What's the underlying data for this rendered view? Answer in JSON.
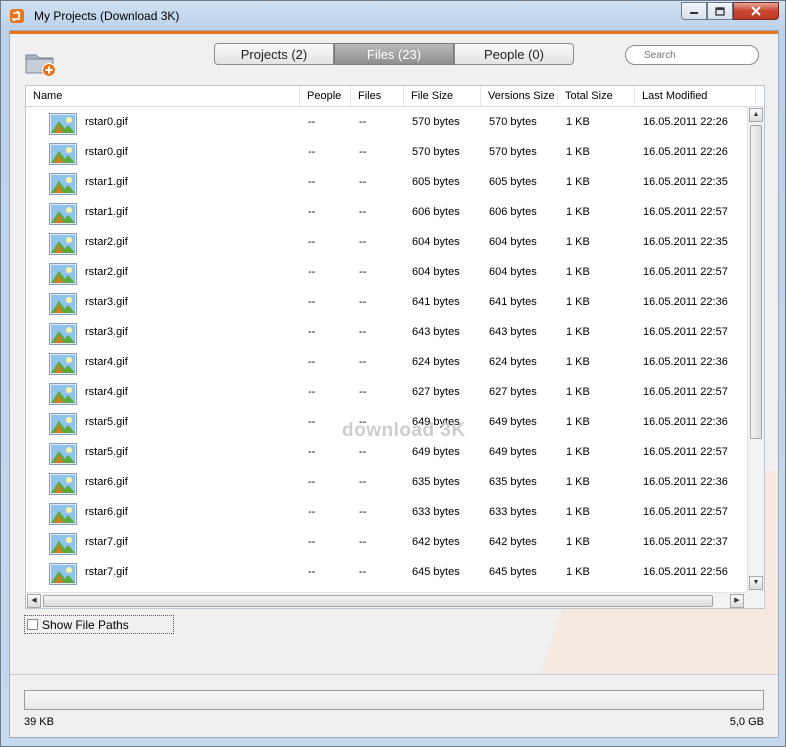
{
  "window": {
    "title": "My Projects (Download 3K)"
  },
  "tabs": [
    {
      "label": "Projects (2)"
    },
    {
      "label": "Files (23)"
    },
    {
      "label": "People (0)"
    }
  ],
  "active_tab": "Files (23)",
  "search": {
    "placeholder": "Search"
  },
  "table": {
    "columns": [
      "Name",
      "People",
      "Files",
      "File Size",
      "Versions Size",
      "Total Size",
      "Last Modified"
    ],
    "rows": [
      {
        "name": "rstar0.gif",
        "people": "--",
        "files": "--",
        "file_size": "570 bytes",
        "versions_size": "570 bytes",
        "total_size": "1 KB",
        "modified": "16.05.2011 22:26"
      },
      {
        "name": "rstar0.gif",
        "people": "--",
        "files": "--",
        "file_size": "570 bytes",
        "versions_size": "570 bytes",
        "total_size": "1 KB",
        "modified": "16.05.2011 22:26"
      },
      {
        "name": "rstar1.gif",
        "people": "--",
        "files": "--",
        "file_size": "605 bytes",
        "versions_size": "605 bytes",
        "total_size": "1 KB",
        "modified": "16.05.2011 22:35"
      },
      {
        "name": "rstar1.gif",
        "people": "--",
        "files": "--",
        "file_size": "606 bytes",
        "versions_size": "606 bytes",
        "total_size": "1 KB",
        "modified": "16.05.2011 22:57"
      },
      {
        "name": "rstar2.gif",
        "people": "--",
        "files": "--",
        "file_size": "604 bytes",
        "versions_size": "604 bytes",
        "total_size": "1 KB",
        "modified": "16.05.2011 22:35"
      },
      {
        "name": "rstar2.gif",
        "people": "--",
        "files": "--",
        "file_size": "604 bytes",
        "versions_size": "604 bytes",
        "total_size": "1 KB",
        "modified": "16.05.2011 22:57"
      },
      {
        "name": "rstar3.gif",
        "people": "--",
        "files": "--",
        "file_size": "641 bytes",
        "versions_size": "641 bytes",
        "total_size": "1 KB",
        "modified": "16.05.2011 22:36"
      },
      {
        "name": "rstar3.gif",
        "people": "--",
        "files": "--",
        "file_size": "643 bytes",
        "versions_size": "643 bytes",
        "total_size": "1 KB",
        "modified": "16.05.2011 22:57"
      },
      {
        "name": "rstar4.gif",
        "people": "--",
        "files": "--",
        "file_size": "624 bytes",
        "versions_size": "624 bytes",
        "total_size": "1 KB",
        "modified": "16.05.2011 22:36"
      },
      {
        "name": "rstar4.gif",
        "people": "--",
        "files": "--",
        "file_size": "627 bytes",
        "versions_size": "627 bytes",
        "total_size": "1 KB",
        "modified": "16.05.2011 22:57"
      },
      {
        "name": "rstar5.gif",
        "people": "--",
        "files": "--",
        "file_size": "649 bytes",
        "versions_size": "649 bytes",
        "total_size": "1 KB",
        "modified": "16.05.2011 22:36"
      },
      {
        "name": "rstar5.gif",
        "people": "--",
        "files": "--",
        "file_size": "649 bytes",
        "versions_size": "649 bytes",
        "total_size": "1 KB",
        "modified": "16.05.2011 22:57"
      },
      {
        "name": "rstar6.gif",
        "people": "--",
        "files": "--",
        "file_size": "635 bytes",
        "versions_size": "635 bytes",
        "total_size": "1 KB",
        "modified": "16.05.2011 22:36"
      },
      {
        "name": "rstar6.gif",
        "people": "--",
        "files": "--",
        "file_size": "633 bytes",
        "versions_size": "633 bytes",
        "total_size": "1 KB",
        "modified": "16.05.2011 22:57"
      },
      {
        "name": "rstar7.gif",
        "people": "--",
        "files": "--",
        "file_size": "642 bytes",
        "versions_size": "642 bytes",
        "total_size": "1 KB",
        "modified": "16.05.2011 22:37"
      },
      {
        "name": "rstar7.gif",
        "people": "--",
        "files": "--",
        "file_size": "645 bytes",
        "versions_size": "645 bytes",
        "total_size": "1 KB",
        "modified": "16.05.2011 22:56"
      }
    ]
  },
  "watermark": "download 3K",
  "show_file_paths": {
    "label": "Show File Paths",
    "checked": false
  },
  "status": {
    "left": "39 KB",
    "right": "5,0 GB"
  },
  "icons": {
    "app": "download3k-app-icon",
    "add_folder": "add-folder-icon",
    "file_thumb": "image-file-icon",
    "search": "search-icon"
  },
  "colors": {
    "accent": "#e8731d",
    "active_tab": "#9a9a9a",
    "close_button": "#c9442f"
  }
}
